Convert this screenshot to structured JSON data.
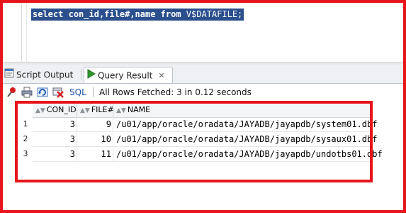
{
  "editor": {
    "sql_keyword_select": "select",
    "sql_columns": "con_id,file#,name",
    "sql_keyword_from": "from",
    "sql_table": "V$DATAFILE;"
  },
  "tabs": [
    {
      "label": "Script Output",
      "icon": "script-output-icon",
      "active": false
    },
    {
      "label": "Query Result",
      "icon": "play-icon",
      "active": true,
      "close": "✕"
    }
  ],
  "toolbar": {
    "sql_label": "SQL",
    "status": "All Rows Fetched: 3 in 0.12 seconds",
    "icons": [
      "pin-icon",
      "print-icon",
      "refresh-icon",
      "delete-icon"
    ]
  },
  "grid": {
    "columns": [
      "CON_ID",
      "FILE#",
      "NAME"
    ],
    "rows": [
      {
        "num": "1",
        "con_id": "3",
        "file": "9",
        "name": "/u01/app/oracle/oradata/JAYADB/jayapdb/system01.dbf"
      },
      {
        "num": "2",
        "con_id": "3",
        "file": "10",
        "name": "/u01/app/oracle/oradata/JAYADB/jayapdb/sysaux01.dbf"
      },
      {
        "num": "3",
        "con_id": "3",
        "file": "11",
        "name": "/u01/app/oracle/oradata/JAYADB/jayapdb/undotbs01.dbf"
      }
    ]
  },
  "colors": {
    "highlight": "#e8141b",
    "selection": "#2b4f8c"
  }
}
